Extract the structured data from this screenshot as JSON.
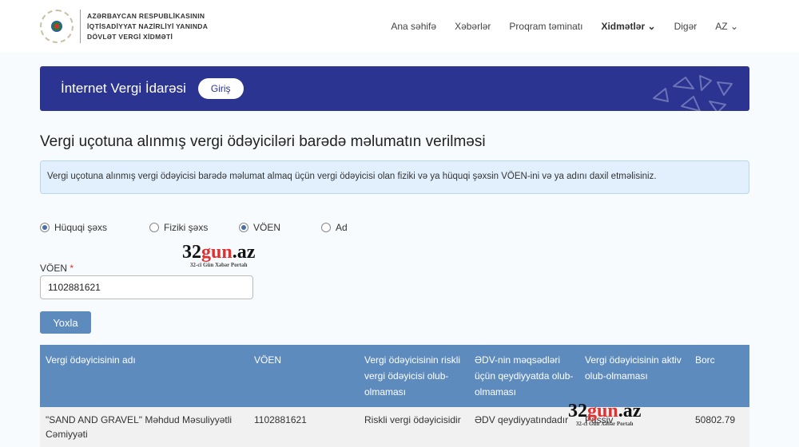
{
  "header": {
    "org_lines": [
      "AZƏRBAYCAN RESPUBLİKASININ",
      "İQTİSADİYYAT NAZİRLİYİ YANINDA",
      "DÖVLƏT VERGİ XİDMƏTİ"
    ],
    "nav": [
      "Ana səhifə",
      "Xəbərlər",
      "Proqram təminatı",
      "Xidmətlər",
      "Digər",
      "AZ"
    ]
  },
  "banner": {
    "title": "İnternet Vergi İdarəsi",
    "login": "Giriş"
  },
  "page_title": "Vergi uçotuna alınmış vergi ödəyiciləri barədə məlumatın verilməsi",
  "info": "Vergi uçotuna alınmış vergi ödəyicisi barədə məlumat almaq üçün vergi ödəyicisi olan fiziki və ya hüquqi şəxsin VÖEN-ini və ya adını daxil etməlisiniz.",
  "radios": [
    {
      "label": "Hüquqi şəxs",
      "checked": true
    },
    {
      "label": "Fiziki şəxs",
      "checked": false
    },
    {
      "label": "VÖEN",
      "checked": true
    },
    {
      "label": "Ad",
      "checked": false
    }
  ],
  "form": {
    "label": "VÖEN",
    "required": "*",
    "value": "1102881621",
    "button": "Yoxla"
  },
  "table": {
    "headers": [
      "Vergi ödəyicisinin adı",
      "VÖEN",
      "Vergi ödəyicisinin riskli vergi ödəyicisi olub-olmaması",
      "ƏDV-nin məqsədləri üçün qeydiyyatda olub-olmaması",
      "Vergi ödəyicisinin aktiv olub-olmaması",
      "Borc"
    ],
    "rows": [
      [
        "\"SAND AND GRAVEL\" Məhdud Məsuliyyətli Cəmiyyəti",
        "1102881621",
        "Riskli vergi ödəyicisidir",
        "ƏDV qeydiyyatındadır",
        "Passiv",
        "50802.79"
      ]
    ]
  },
  "watermark": {
    "main_a": "32",
    "main_b": "gun",
    ".az": ".az",
    "sub": "32-ci Gün Xəbər Portalı"
  },
  "colors": {
    "banner": "#2b3490",
    "table_header": "#5d8bbe",
    "accent_red": "#e03030"
  }
}
